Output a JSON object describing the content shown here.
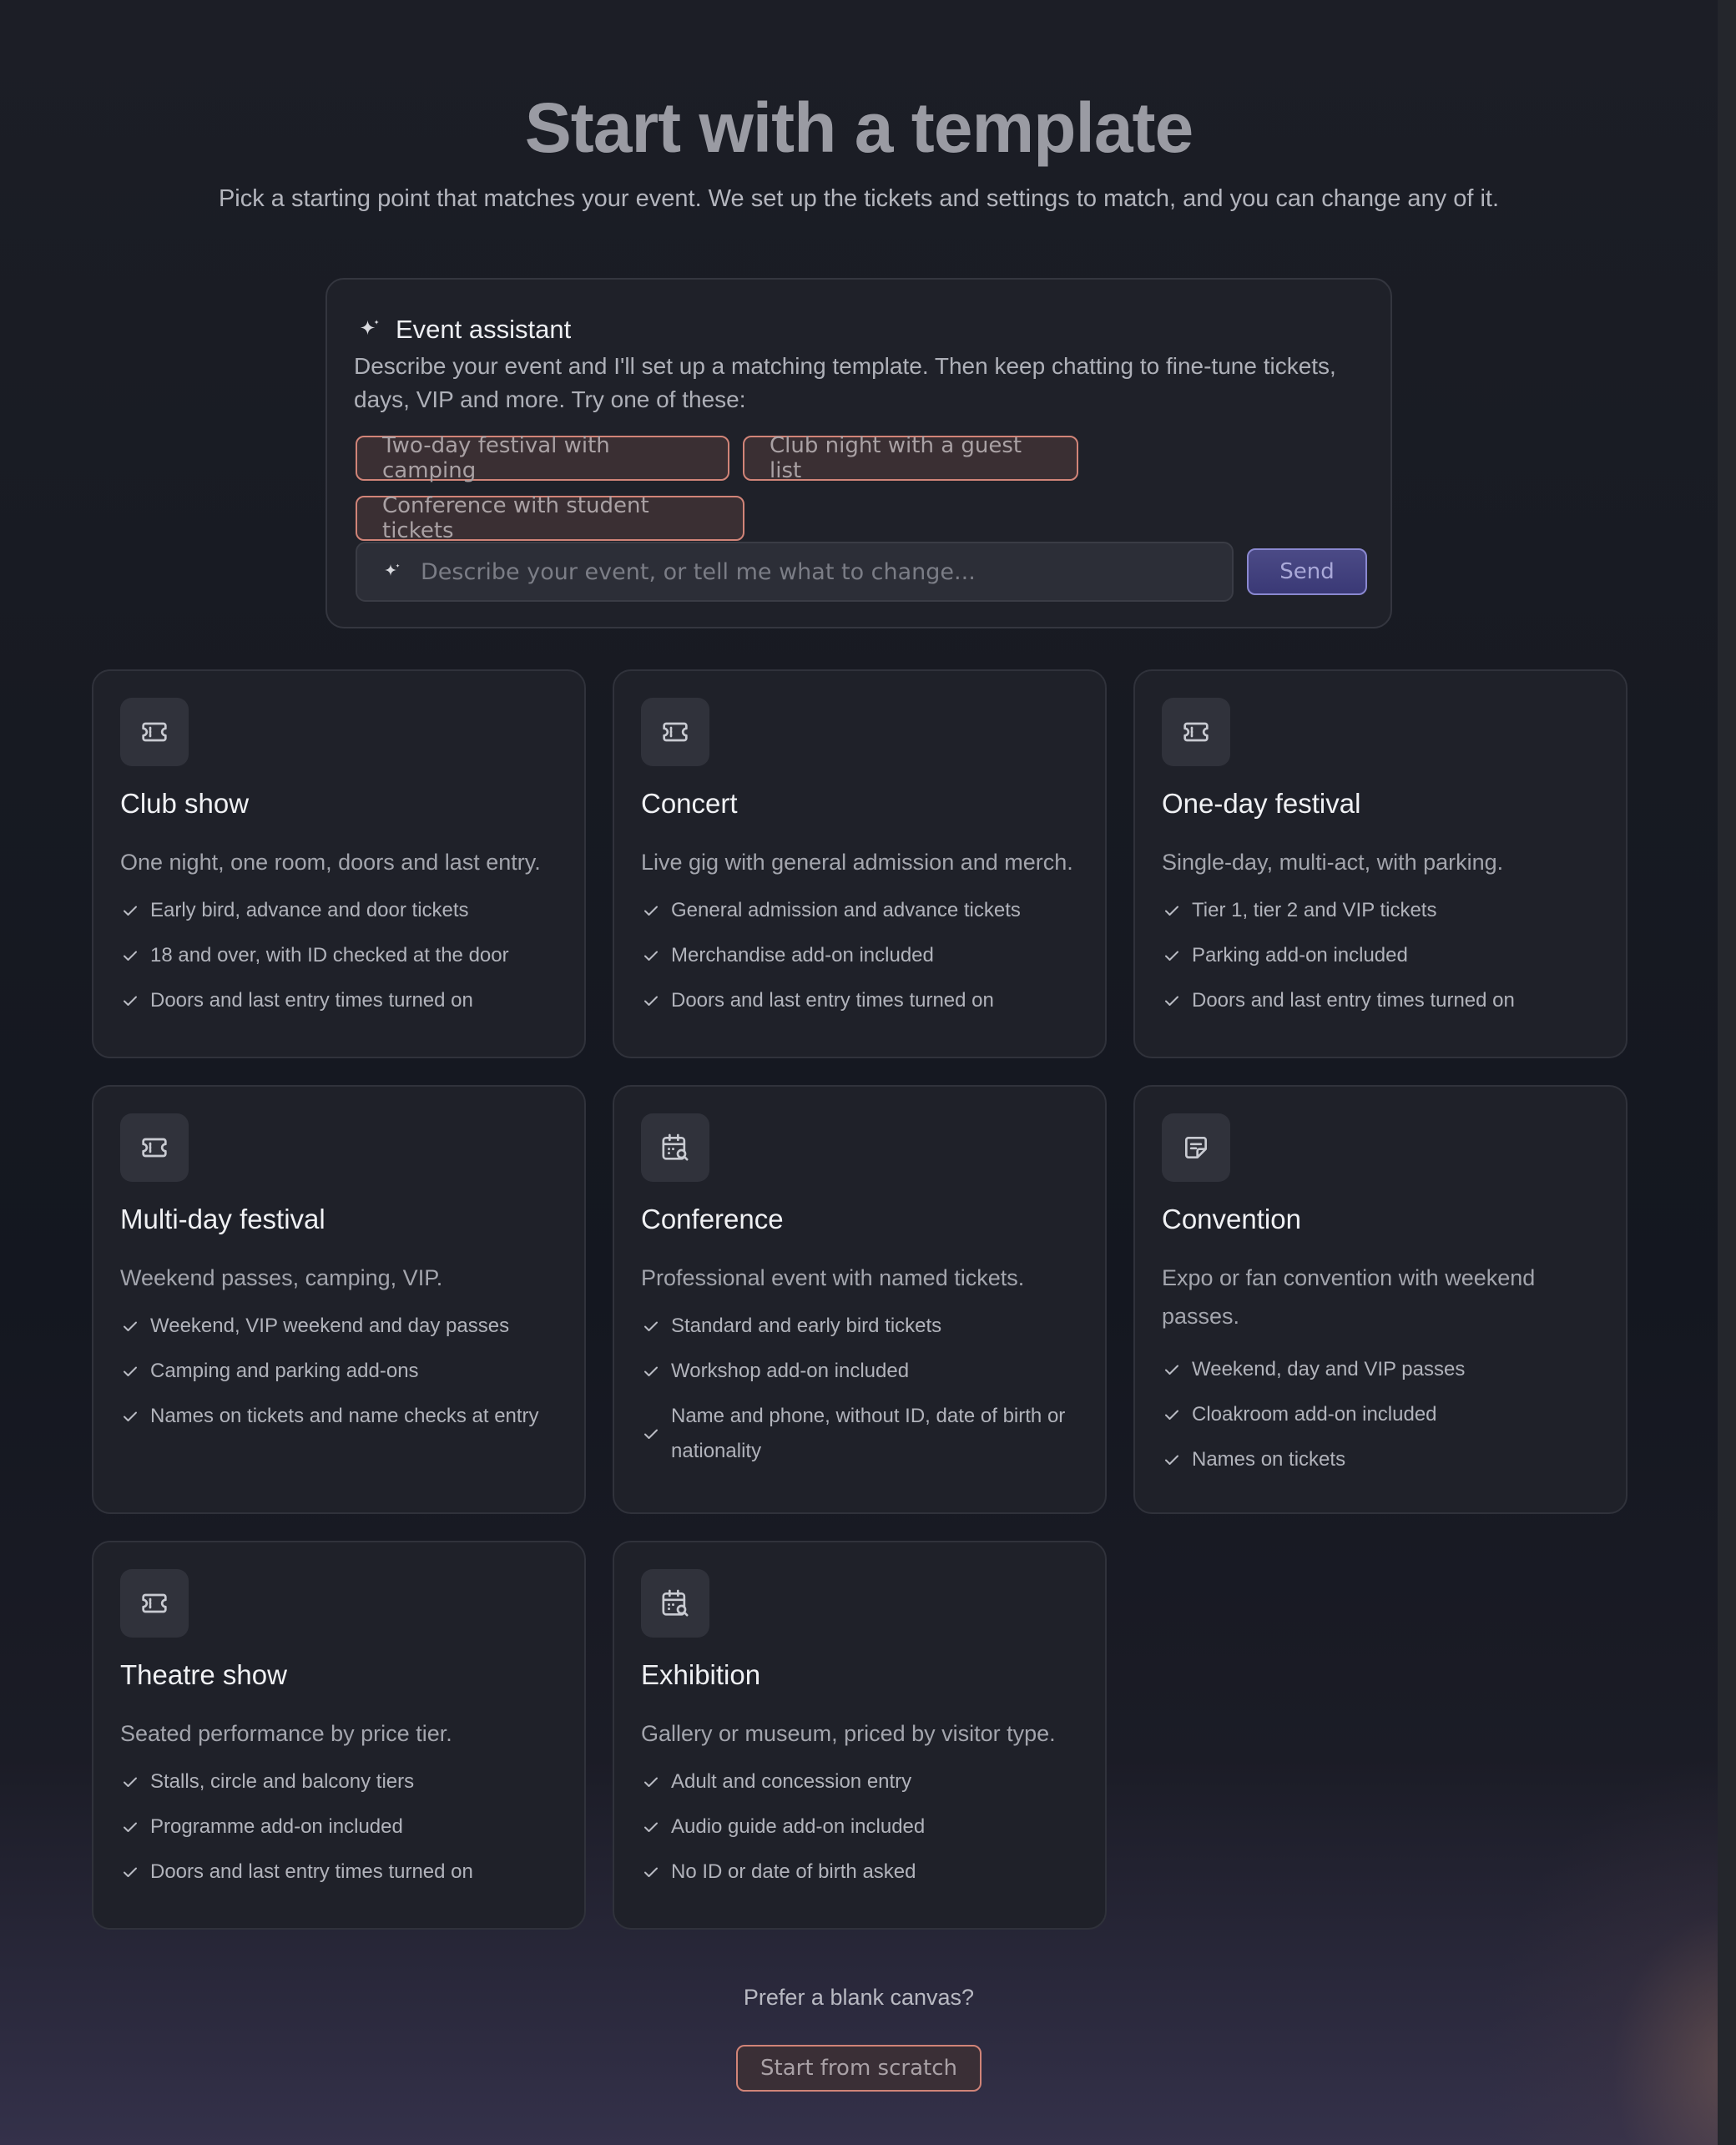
{
  "header": {
    "title": "Start with a template",
    "subtitle": "Pick a starting point that matches your event. We set up the tickets and settings to match, and you can change any of it."
  },
  "assistant": {
    "title": "Event assistant",
    "description": "Describe your event and I'll set up a matching template. Then keep chatting to fine-tune tickets, days, VIP and more. Try one of these:",
    "suggestions": [
      "Two-day festival with camping",
      "Club night with a guest list",
      "Conference with student tickets"
    ],
    "input_placeholder": "Describe your event, or tell me what to change...",
    "send_label": "Send"
  },
  "templates": [
    {
      "icon": "ticket-icon",
      "title": "Club show",
      "description": "One night, one room, doors and last entry.",
      "features": [
        "Early bird, advance and door tickets",
        "18 and over, with ID checked at the door",
        "Doors and last entry times turned on"
      ]
    },
    {
      "icon": "ticket-icon",
      "title": "Concert",
      "description": "Live gig with general admission and merch.",
      "features": [
        "General admission and advance tickets",
        "Merchandise add-on included",
        "Doors and last entry times turned on"
      ]
    },
    {
      "icon": "ticket-icon",
      "title": "One-day festival",
      "description": "Single-day, multi-act, with parking.",
      "features": [
        "Tier 1, tier 2 and VIP tickets",
        "Parking add-on included",
        "Doors and last entry times turned on"
      ]
    },
    {
      "icon": "ticket-icon",
      "title": "Multi-day festival",
      "description": "Weekend passes, camping, VIP.",
      "features": [
        "Weekend, VIP weekend and day passes",
        "Camping and parking add-ons",
        "Names on tickets and name checks at entry"
      ]
    },
    {
      "icon": "calendar-search-icon",
      "title": "Conference",
      "description": "Professional event with named tickets.",
      "features": [
        "Standard and early bird tickets",
        "Workshop add-on included",
        "Name and phone, without ID, date of birth or nationality"
      ]
    },
    {
      "icon": "sticky-note-icon",
      "title": "Convention",
      "description": "Expo or fan convention with weekend passes.",
      "features": [
        "Weekend, day and VIP passes",
        "Cloakroom add-on included",
        "Names on tickets"
      ]
    },
    {
      "icon": "ticket-icon",
      "title": "Theatre show",
      "description": "Seated performance by price tier.",
      "features": [
        "Stalls, circle and balcony tiers",
        "Programme add-on included",
        "Doors and last entry times turned on"
      ]
    },
    {
      "icon": "calendar-search-icon",
      "title": "Exhibition",
      "description": "Gallery or museum, priced by visitor type.",
      "features": [
        "Adult and concession entry",
        "Audio guide add-on included",
        "No ID or date of birth asked"
      ]
    }
  ],
  "footer": {
    "prompt": "Prefer a blank canvas?",
    "scratch_label": "Start from scratch"
  }
}
